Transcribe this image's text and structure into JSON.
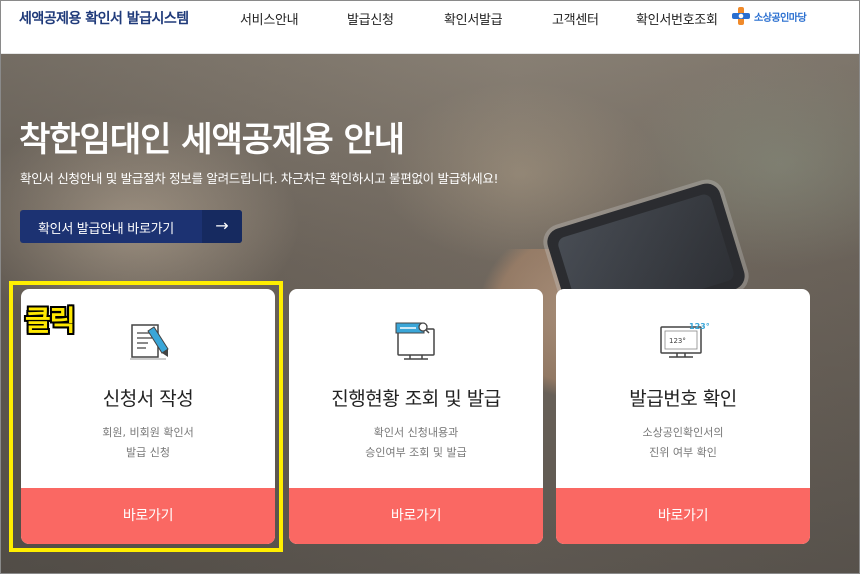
{
  "header": {
    "brand": "세액공제용 확인서 발급시스템",
    "nav": [
      "서비스안내",
      "발급신청",
      "확인서발급",
      "고객센터",
      "확인서번호조회"
    ],
    "logo_text": "소상공인마당",
    "logo_icon": "plus-circle-icon"
  },
  "hero": {
    "title": "착한임대인 세액공제용 안내",
    "subtitle": "확인서 신청안내 및 발급절차 정보를 알려드립니다. 차근차근 확인하시고 불편없이 발급하세요!",
    "cta_label": "확인서 발급안내 바로가기",
    "cta_arrow": "→"
  },
  "cards": [
    {
      "icon": "document-pen-icon",
      "title": "신청서 작성",
      "desc": [
        "회원, 비회원 확인서",
        "발급 신청"
      ],
      "button": "바로가기"
    },
    {
      "icon": "monitor-search-icon",
      "title": "진행현황 조회 및 발급",
      "desc": [
        "확인서 신청내용과",
        "승인여부 조회 및 발급"
      ],
      "button": "바로가기"
    },
    {
      "icon": "monitor-number-icon",
      "title": "발급번호 확인",
      "desc": [
        "소상공인확인서의",
        "진위 여부 확인"
      ],
      "button": "바로가기"
    }
  ],
  "annotation": {
    "label": "클릭",
    "color": "#ffee00"
  },
  "colors": {
    "brand": "#1f3a7a",
    "cta": "#1c3272",
    "card_button": "#fa6863"
  }
}
